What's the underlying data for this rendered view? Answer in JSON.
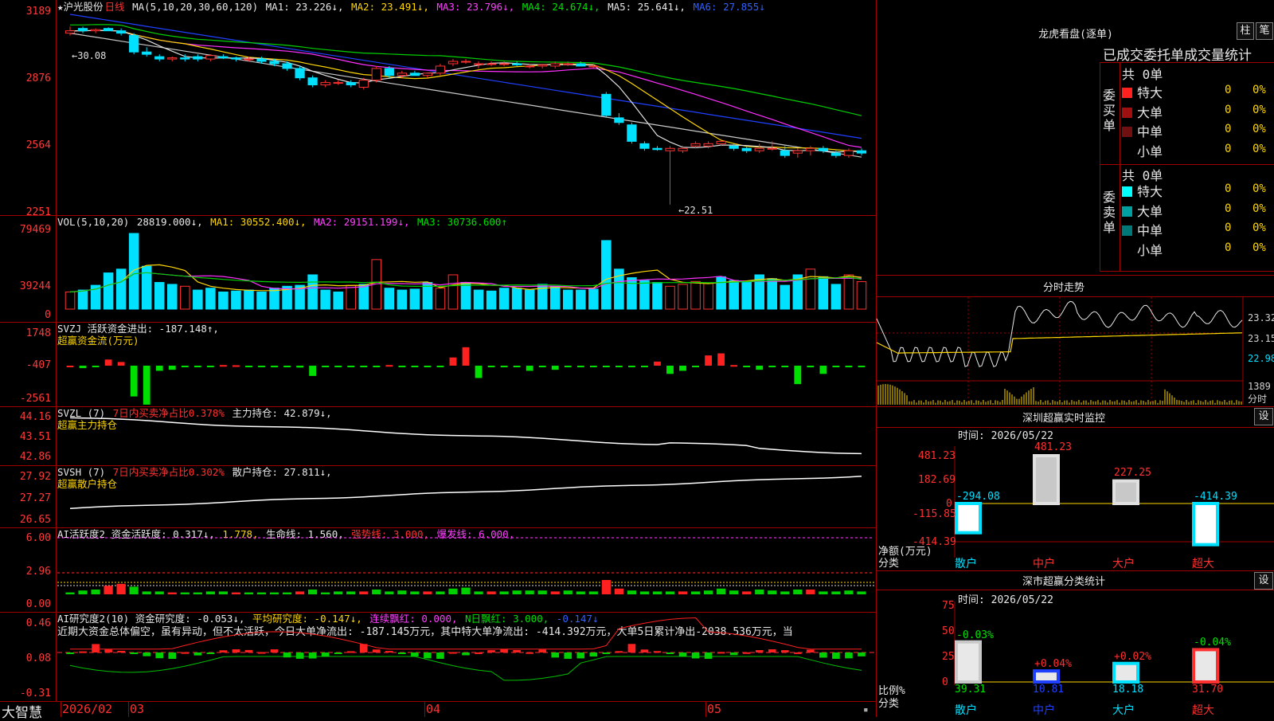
{
  "main": {
    "header": [
      {
        "text": "★沪光股份",
        "cls": "w"
      },
      {
        "text": "日线",
        "cls": "r"
      },
      {
        "text": " MA(5,10,20,30,60,120) ",
        "cls": "w"
      },
      {
        "text": "MA1: 23.226↓,",
        "cls": "w"
      },
      {
        "text": " MA2: 23.491↓,",
        "cls": "y"
      },
      {
        "text": " MA3: 23.796↓,",
        "cls": "m"
      },
      {
        "text": " MA4: 24.674↓,",
        "cls": "g"
      },
      {
        "text": " MA5: 25.641↓,",
        "cls": "w"
      },
      {
        "text": " MA6: 27.855↓",
        "cls": "b"
      }
    ],
    "y_labels": [
      "3189",
      "2876",
      "2564",
      "2251"
    ],
    "hi_label": "←30.08",
    "lo_label": "←22.51"
  },
  "vol": {
    "header": [
      {
        "text": "VOL(5,10,20) ",
        "cls": "w"
      },
      {
        "text": "28819.000↓,",
        "cls": "w"
      },
      {
        "text": " MA1: 30552.400↓,",
        "cls": "y"
      },
      {
        "text": " MA2: 29151.199↓,",
        "cls": "m"
      },
      {
        "text": " MA3: 30736.600↑",
        "cls": "g"
      }
    ],
    "y_labels": [
      "79469",
      "39244",
      "0"
    ]
  },
  "svzj": {
    "header": [
      {
        "text": "SVZJ  活跃资金进出: -187.148↑,",
        "cls": "w"
      }
    ],
    "header2": "超赢资金流(万元)",
    "y_labels": [
      "1748",
      "-407",
      "-2561"
    ]
  },
  "svzl": {
    "header": [
      {
        "text": "SVZL (7) ",
        "cls": "w"
      },
      {
        "text": "7日内买卖净占比0.378% ",
        "cls": "r"
      },
      {
        "text": "主力持仓: 42.879↓,",
        "cls": "w"
      }
    ],
    "header2": "超赢主力持仓",
    "y_labels": [
      "44.16",
      "43.51",
      "42.86"
    ]
  },
  "svsh": {
    "header": [
      {
        "text": "SVSH (7) ",
        "cls": "w"
      },
      {
        "text": "7日内买卖净占比0.302% ",
        "cls": "r"
      },
      {
        "text": "散户持仓: 27.811↓,",
        "cls": "w"
      }
    ],
    "header2": "超赢散户持仓",
    "y_labels": [
      "27.92",
      "27.27",
      "26.65"
    ]
  },
  "ai1": {
    "header": [
      {
        "text": "AI活跃度2 资金活跃度: 0.317↓,",
        "cls": "w"
      },
      {
        "text": " 1.778,",
        "cls": "y"
      },
      {
        "text": " 生命线: 1.560,",
        "cls": "w"
      },
      {
        "text": " 强势线: 3.000,",
        "cls": "r"
      },
      {
        "text": " 爆发线: 6.000,",
        "cls": "m"
      }
    ],
    "y_labels": [
      "6.00",
      "2.96",
      "0.00"
    ]
  },
  "ai2": {
    "header": [
      {
        "text": "AI研究度2(10) 资金研究度: -0.053↓,",
        "cls": "w"
      },
      {
        "text": " 平均研究度: -0.147↓,",
        "cls": "y"
      },
      {
        "text": " 连续飘红: 0.000,",
        "cls": "m"
      },
      {
        "text": " N日飘红: 3.000,",
        "cls": "g"
      },
      {
        "text": " -0.147↓",
        "cls": "b"
      }
    ],
    "comment": "近期大资金总体偏空，虽有异动，但不太活跃，今日大单净流出: -187.145万元，其中特大单净流出: -414.392万元，大单5日累计净出-2038.536万元，当",
    "y_labels": [
      "0.46",
      "0.08",
      "-0.31"
    ]
  },
  "bottom": {
    "brand": "大智慧",
    "dates": [
      "2026/02",
      "03",
      "04",
      "05"
    ]
  },
  "side": {
    "dragon_title": "龙虎看盘(逐单)",
    "btn_zhu": "柱",
    "btn_bi": "笔",
    "stat_title": "已成交委托单成交量统计",
    "buy_label": "委买单",
    "sell_label": "委卖单",
    "buy_total": "共 0单",
    "sell_total": "共 0单",
    "buy_rows": [
      {
        "label": "特大",
        "val": "0",
        "pct": "0%",
        "color": "#ff2020"
      },
      {
        "label": "大单",
        "val": "0",
        "pct": "0%",
        "color": "#a01010"
      },
      {
        "label": "中单",
        "val": "0",
        "pct": "0%",
        "color": "#701010"
      },
      {
        "label": "小单",
        "val": "0",
        "pct": "0%",
        "color": ""
      }
    ],
    "sell_rows": [
      {
        "label": "特大",
        "val": "0",
        "pct": "0%",
        "color": "#00ffff"
      },
      {
        "label": "大单",
        "val": "0",
        "pct": "0%",
        "color": "#00a0a0"
      },
      {
        "label": "中单",
        "val": "0",
        "pct": "0%",
        "color": "#007878"
      },
      {
        "label": "小单",
        "val": "0",
        "pct": "0%",
        "color": ""
      }
    ],
    "intraday_title": "分时走势",
    "intraday_labels": [
      "23.32",
      "23.15",
      "22.98",
      "1389",
      "分时"
    ],
    "monitor_title": "深圳超赢实时监控",
    "set_label": "设",
    "monitor_time": "时间: 2026/05/22",
    "monitor_y": [
      "481.23",
      "182.69",
      "0",
      "-115.85",
      "-414.39"
    ],
    "monitor_vals": [
      "-294.08",
      "481.23",
      "227.25",
      "-414.39"
    ],
    "monitor_cats": [
      "散户",
      "中户",
      "大户",
      "超大"
    ],
    "monitor_left1": "净额(万元)",
    "monitor_left2": "分类",
    "class_title": "深市超赢分类统计",
    "class_time": "时间: 2026/05/22",
    "class_y": [
      "75",
      "50",
      "25",
      "0"
    ],
    "class_pcts": [
      "-0.03%",
      "+0.04%",
      "+0.02%",
      "-0.04%"
    ],
    "class_vals": [
      "39.31",
      "10.81",
      "18.18",
      "31.70"
    ],
    "class_cats": [
      "散户",
      "中户",
      "大户",
      "超大"
    ],
    "class_left1": "比例%",
    "class_left2": "分类"
  },
  "chart_data": {
    "type": "candlestick",
    "ylim": [
      22.3,
      30.6
    ],
    "candles": [
      [
        29.8,
        30.08,
        29.7,
        29.9
      ],
      [
        30.0,
        30.08,
        29.8,
        29.9
      ],
      [
        29.9,
        30.0,
        29.8,
        29.95
      ],
      [
        30.0,
        30.05,
        29.9,
        29.9
      ],
      [
        29.9,
        30.0,
        29.7,
        29.8
      ],
      [
        29.7,
        29.8,
        28.9,
        29.0
      ],
      [
        29.0,
        29.2,
        28.8,
        28.9
      ],
      [
        28.8,
        28.9,
        28.6,
        28.7
      ],
      [
        28.7,
        28.8,
        28.6,
        28.75
      ],
      [
        28.75,
        28.9,
        28.6,
        28.7
      ],
      [
        28.8,
        28.9,
        28.6,
        28.7
      ],
      [
        28.7,
        28.9,
        28.6,
        28.85
      ],
      [
        28.8,
        28.9,
        28.7,
        28.75
      ],
      [
        28.75,
        28.8,
        28.6,
        28.7
      ],
      [
        28.7,
        28.8,
        28.6,
        28.7
      ],
      [
        28.7,
        28.8,
        28.5,
        28.6
      ],
      [
        28.6,
        28.7,
        28.4,
        28.5
      ],
      [
        28.5,
        28.6,
        28.2,
        28.3
      ],
      [
        28.3,
        28.4,
        27.8,
        27.9
      ],
      [
        27.9,
        28.0,
        27.5,
        27.6
      ],
      [
        27.6,
        27.8,
        27.5,
        27.7
      ],
      [
        27.7,
        27.8,
        27.6,
        27.7
      ],
      [
        27.7,
        27.8,
        27.5,
        27.6
      ],
      [
        27.5,
        27.9,
        27.4,
        27.8
      ],
      [
        27.8,
        28.4,
        27.7,
        28.3
      ],
      [
        28.3,
        28.4,
        27.9,
        28.0
      ],
      [
        28.0,
        28.2,
        27.9,
        28.1
      ],
      [
        28.1,
        28.2,
        28.0,
        28.0
      ],
      [
        28.0,
        28.1,
        27.9,
        28.1
      ],
      [
        28.1,
        28.5,
        28.0,
        28.4
      ],
      [
        28.5,
        28.7,
        28.4,
        28.6
      ],
      [
        28.6,
        28.7,
        28.5,
        28.6
      ],
      [
        28.5,
        28.6,
        28.3,
        28.5
      ],
      [
        28.5,
        28.6,
        28.4,
        28.5
      ],
      [
        28.5,
        28.6,
        28.4,
        28.5
      ],
      [
        28.5,
        28.6,
        28.4,
        28.45
      ],
      [
        28.4,
        28.5,
        28.3,
        28.4
      ],
      [
        28.4,
        28.5,
        28.3,
        28.45
      ],
      [
        28.4,
        28.6,
        28.3,
        28.5
      ],
      [
        28.5,
        28.6,
        28.4,
        28.5
      ],
      [
        28.5,
        28.6,
        28.4,
        28.4
      ],
      [
        28.4,
        28.5,
        28.3,
        28.4
      ],
      [
        27.2,
        27.3,
        26.2,
        26.3
      ],
      [
        26.2,
        26.4,
        25.9,
        26.0
      ],
      [
        25.9,
        26.0,
        25.1,
        25.2
      ],
      [
        25.1,
        25.2,
        24.8,
        24.9
      ],
      [
        24.9,
        25.0,
        24.8,
        24.85
      ],
      [
        24.8,
        25.0,
        22.51,
        24.9
      ],
      [
        24.8,
        25.0,
        24.7,
        24.9
      ],
      [
        25.0,
        25.2,
        24.9,
        25.1
      ],
      [
        25.0,
        25.2,
        24.9,
        25.1
      ],
      [
        25.1,
        25.3,
        25.0,
        25.2
      ],
      [
        25.0,
        25.1,
        24.8,
        24.9
      ],
      [
        24.9,
        25.0,
        24.7,
        24.8
      ],
      [
        24.8,
        25.1,
        24.7,
        24.9
      ],
      [
        24.9,
        25.2,
        24.8,
        24.9
      ],
      [
        24.8,
        25.0,
        24.5,
        24.6
      ],
      [
        24.7,
        24.9,
        24.5,
        24.8
      ],
      [
        24.8,
        25.0,
        24.6,
        24.9
      ],
      [
        24.9,
        25.0,
        24.7,
        24.8
      ],
      [
        24.7,
        24.8,
        24.5,
        24.6
      ],
      [
        24.6,
        24.9,
        24.5,
        24.8
      ],
      [
        24.8,
        24.9,
        24.6,
        24.7
      ]
    ],
    "volume": [
      [
        18000,
        "r"
      ],
      [
        20000,
        "c"
      ],
      [
        25000,
        "c"
      ],
      [
        38000,
        "c"
      ],
      [
        42000,
        "c"
      ],
      [
        79469,
        "c"
      ],
      [
        45000,
        "c"
      ],
      [
        28000,
        "c"
      ],
      [
        26000,
        "c"
      ],
      [
        24000,
        "r"
      ],
      [
        20000,
        "c"
      ],
      [
        22000,
        "c"
      ],
      [
        18000,
        "c"
      ],
      [
        19000,
        "c"
      ],
      [
        20000,
        "c"
      ],
      [
        18000,
        "c"
      ],
      [
        22000,
        "c"
      ],
      [
        24000,
        "c"
      ],
      [
        25000,
        "c"
      ],
      [
        36000,
        "c"
      ],
      [
        20000,
        "c"
      ],
      [
        18000,
        "c"
      ],
      [
        25000,
        "r"
      ],
      [
        26000,
        "c"
      ],
      [
        52000,
        "r"
      ],
      [
        22000,
        "c"
      ],
      [
        20000,
        "c"
      ],
      [
        21000,
        "c"
      ],
      [
        28000,
        "c"
      ],
      [
        22000,
        "r"
      ],
      [
        36000,
        "r"
      ],
      [
        28000,
        "c"
      ],
      [
        20000,
        "c"
      ],
      [
        19000,
        "c"
      ],
      [
        22000,
        "c"
      ],
      [
        22000,
        "c"
      ],
      [
        20000,
        "c"
      ],
      [
        26000,
        "c"
      ],
      [
        24000,
        "c"
      ],
      [
        20000,
        "c"
      ],
      [
        20000,
        "c"
      ],
      [
        21000,
        "c"
      ],
      [
        72000,
        "c"
      ],
      [
        42000,
        "c"
      ],
      [
        33000,
        "c"
      ],
      [
        30000,
        "c"
      ],
      [
        28000,
        "c"
      ],
      [
        24000,
        "r"
      ],
      [
        26000,
        "r"
      ],
      [
        29000,
        "r"
      ],
      [
        27000,
        "r"
      ],
      [
        34000,
        "c"
      ],
      [
        30000,
        "c"
      ],
      [
        28000,
        "c"
      ],
      [
        36000,
        "c"
      ],
      [
        32000,
        "c"
      ],
      [
        25000,
        "c"
      ],
      [
        36000,
        "c"
      ],
      [
        42000,
        "r"
      ],
      [
        34000,
        "c"
      ],
      [
        26000,
        "c"
      ],
      [
        36000,
        "r"
      ],
      [
        28819,
        "r"
      ]
    ]
  }
}
